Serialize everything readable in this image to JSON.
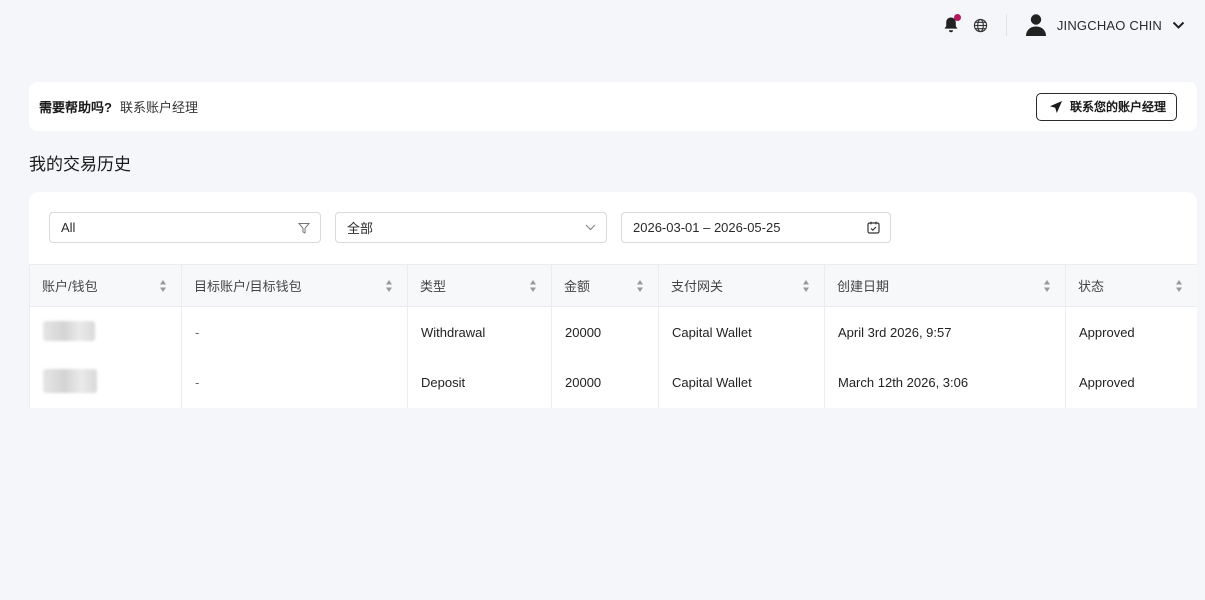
{
  "topbar": {
    "user_name": "JINGCHAO CHIN",
    "icons": [
      "bell-icon",
      "globe-icon",
      "user-avatar-icon",
      "chevron-down-icon"
    ],
    "notification_color": "#b5175c"
  },
  "help": {
    "question": "需要帮助吗?",
    "subtitle": "联系账户经理",
    "button_label": "联系您的账户经理"
  },
  "page": {
    "title": "我的交易历史"
  },
  "filters": {
    "account_filter": "All",
    "type_filter": "全部",
    "date_range": "2026-03-01 – 2026-05-25"
  },
  "table": {
    "columns": [
      "账户/钱包",
      "目标账户/目标钱包",
      "类型",
      "金额",
      "支付网关",
      "创建日期",
      "状态"
    ],
    "rows": [
      {
        "target": "-",
        "type": "Withdrawal",
        "amount": "20000",
        "gateway": "Capital Wallet",
        "date": "April 3rd 2026, 9:57",
        "status": "Approved"
      },
      {
        "target": "-",
        "type": "Deposit",
        "amount": "20000",
        "gateway": "Capital Wallet",
        "date": "March 12th 2026, 3:06",
        "status": "Approved"
      }
    ]
  }
}
